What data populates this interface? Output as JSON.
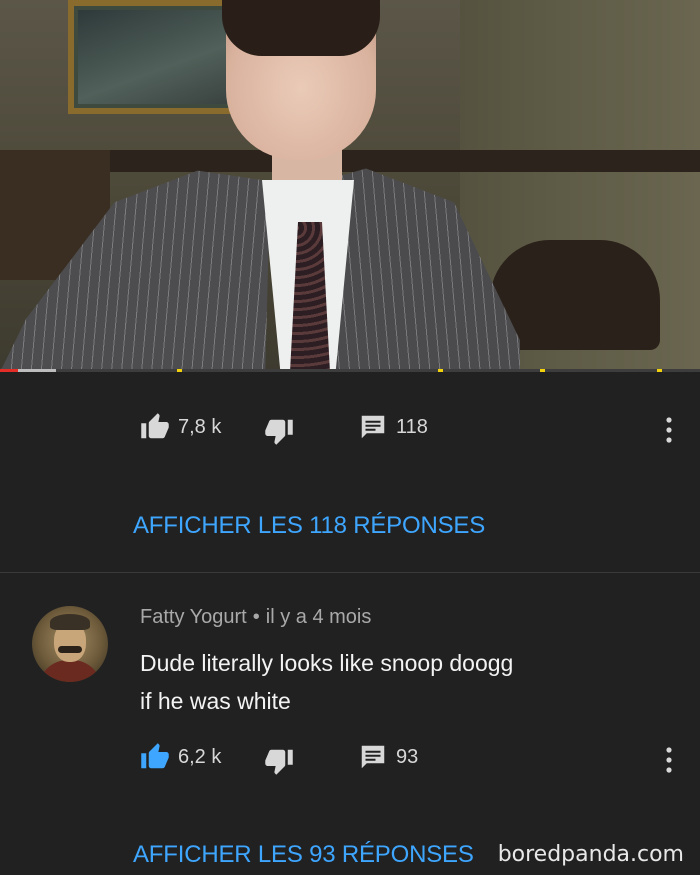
{
  "video": {
    "progress_played_fraction": 0.025,
    "progress_buffered_fraction": 0.08
  },
  "thread": {
    "likes": "7,8 k",
    "replies_count": "118",
    "view_replies_label": "AFFICHER LES 118 RÉPONSES"
  },
  "comment": {
    "author": "Fatty Yogurt",
    "separator": "•",
    "time": "il y a 4 mois",
    "text_line1": "Dude literally looks like snoop doogg",
    "text_line2": "if he was white",
    "likes": "6,2 k",
    "replies_count": "93",
    "view_replies_label": "AFFICHER LES 93 RÉPONSES"
  },
  "watermark": "boredpanda.com",
  "icons": {
    "like": "thumbs-up-icon",
    "dislike": "thumbs-down-icon",
    "reply": "comment-icon",
    "more": "more-vertical-icon"
  },
  "colors": {
    "background": "#212121",
    "link": "#3ea6ff",
    "liked": "#3ea6ff",
    "icon": "#d8d8d8",
    "progress_played": "#e52d27"
  }
}
